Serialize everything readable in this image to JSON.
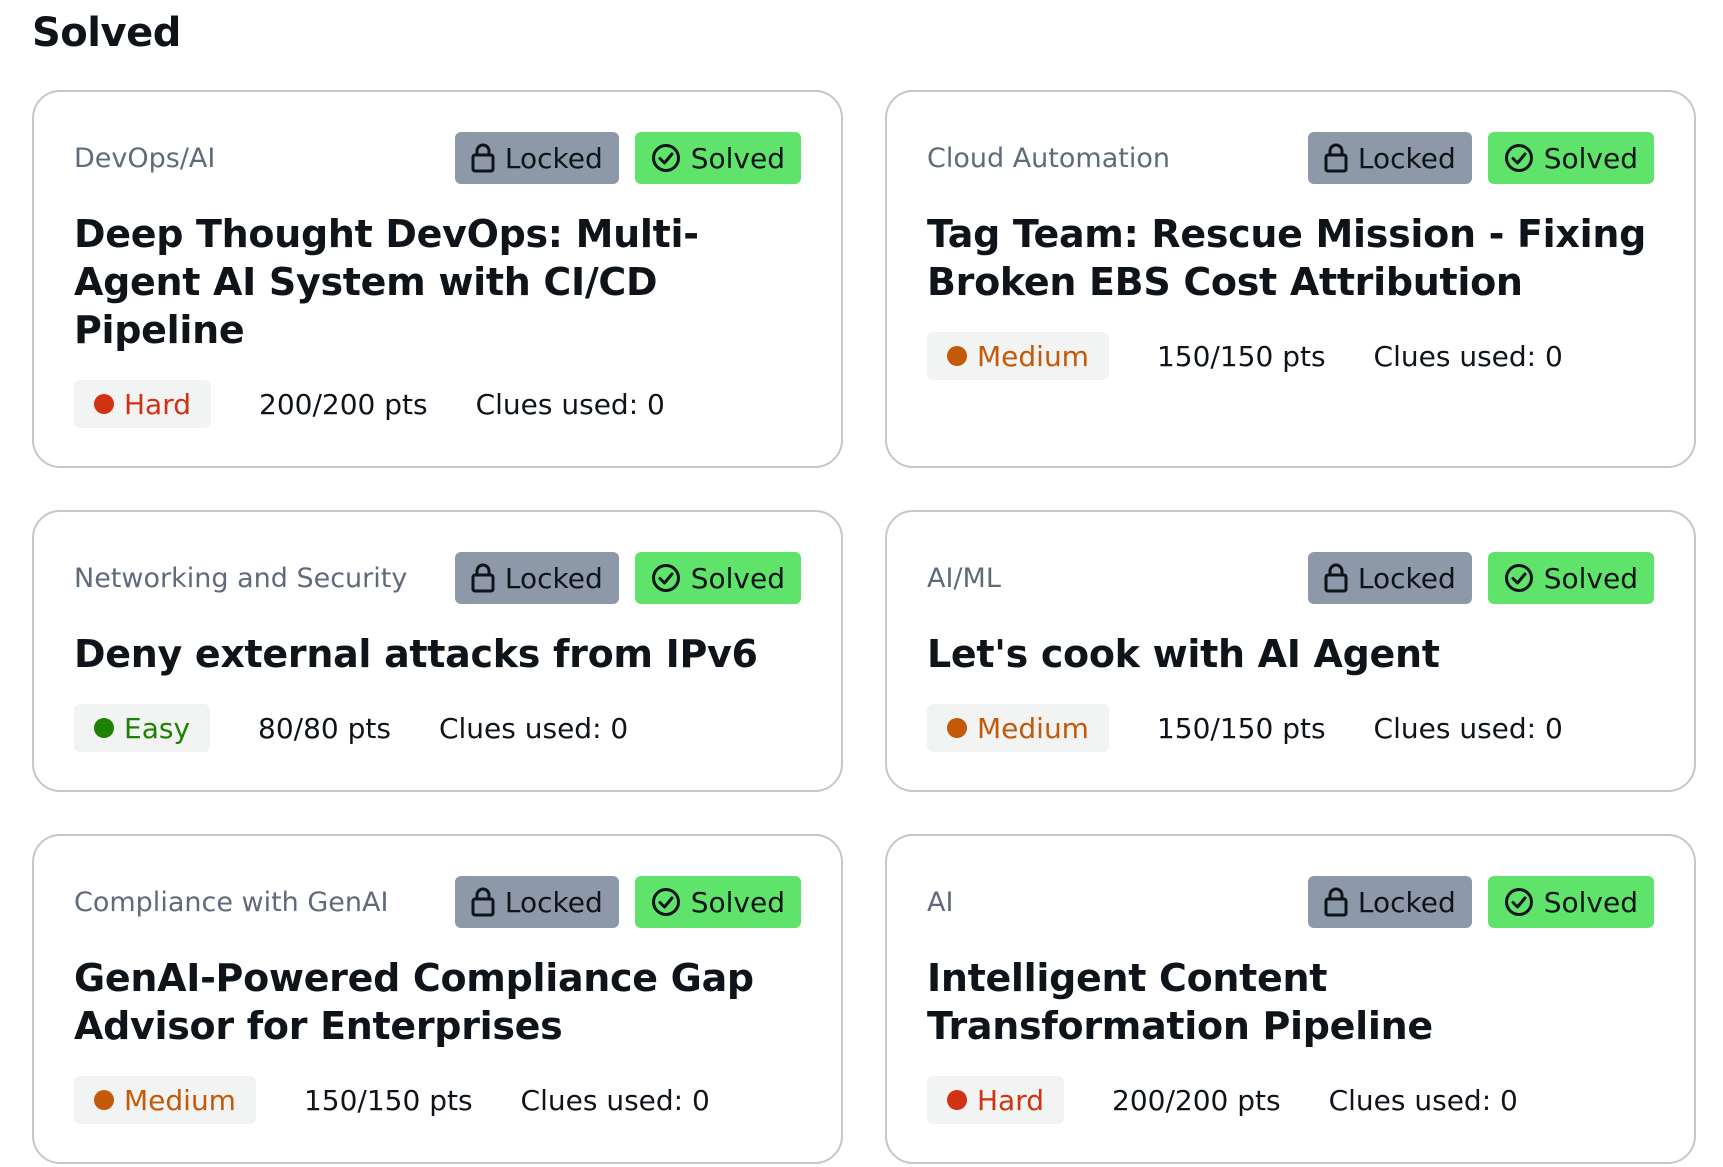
{
  "section_title": "Solved",
  "badges": {
    "locked_label": "Locked",
    "solved_label": "Solved",
    "locked_icon": "lock-icon",
    "solved_icon": "check-circle-icon"
  },
  "colors": {
    "hard": "#d13212",
    "medium": "#c45a07",
    "easy": "#1d8102",
    "solved_badge": "#5fe36a",
    "locked_badge": "#8d99a8"
  },
  "cards": [
    {
      "category": "DevOps/AI",
      "title": "Deep Thought DevOps: Multi-Agent AI System with CI/CD Pipeline",
      "difficulty": "Hard",
      "points": "200/200 pts",
      "clues": "Clues used: 0"
    },
    {
      "category": "Cloud Automation",
      "title": "Tag Team: Rescue Mission - Fixing Broken EBS Cost Attribution",
      "difficulty": "Medium",
      "points": "150/150 pts",
      "clues": "Clues used: 0"
    },
    {
      "category": "Networking and Security",
      "title": "Deny external attacks from IPv6",
      "difficulty": "Easy",
      "points": "80/80 pts",
      "clues": "Clues used: 0"
    },
    {
      "category": "AI/ML",
      "title": "Let's cook with AI Agent",
      "difficulty": "Medium",
      "points": "150/150 pts",
      "clues": "Clues used: 0"
    },
    {
      "category": "Compliance with GenAI",
      "title": "GenAI-Powered Compliance Gap Advisor for Enterprises",
      "difficulty": "Medium",
      "points": "150/150 pts",
      "clues": "Clues used: 0"
    },
    {
      "category": "AI",
      "title": "Intelligent Content Transformation Pipeline",
      "difficulty": "Hard",
      "points": "200/200 pts",
      "clues": "Clues used: 0"
    }
  ]
}
